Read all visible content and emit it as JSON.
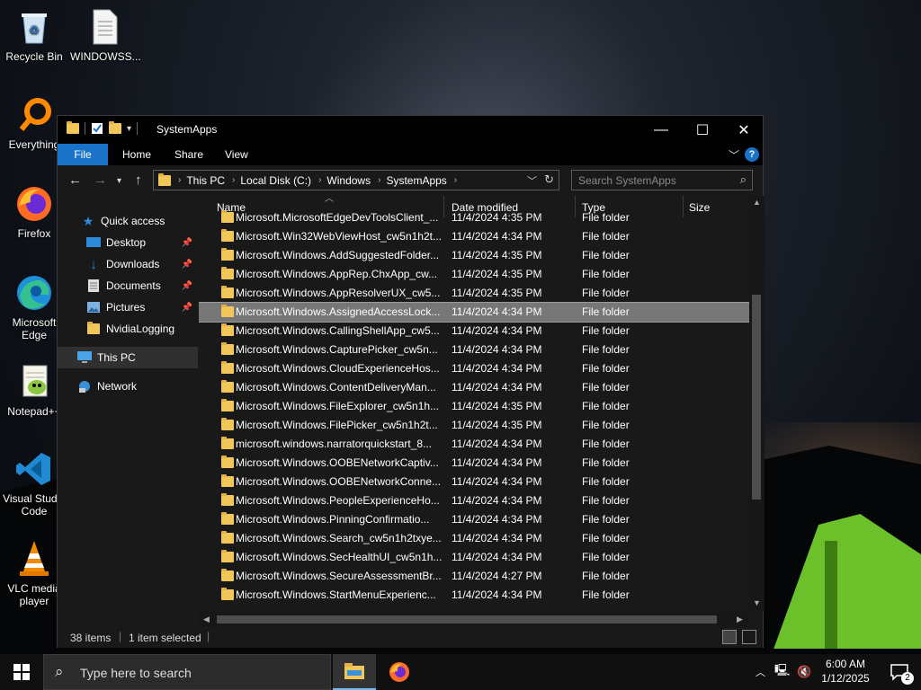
{
  "desktop": {
    "icons": [
      {
        "label": "Recycle Bin"
      },
      {
        "label": "WINDOWSS..."
      },
      {
        "label": "Everything"
      },
      {
        "label": "Firefox"
      },
      {
        "label": "Microsoft Edge"
      },
      {
        "label": "Notepad++"
      },
      {
        "label": "Visual Studio Code"
      },
      {
        "label": "VLC media player"
      }
    ]
  },
  "window": {
    "title": "SystemApps",
    "controls": {
      "minimize": "—",
      "maximize": "☐",
      "close": "✕"
    },
    "ribbon_tabs": [
      "File",
      "Home",
      "Share",
      "View"
    ],
    "help": "?",
    "address": {
      "crumbs": [
        "This PC",
        "Local Disk (C:)",
        "Windows",
        "SystemApps"
      ]
    },
    "search": {
      "placeholder": "Search SystemApps"
    },
    "nav": {
      "quick_access": "Quick access",
      "items": [
        {
          "label": "Desktop",
          "pinned": true
        },
        {
          "label": "Downloads",
          "pinned": true
        },
        {
          "label": "Documents",
          "pinned": true
        },
        {
          "label": "Pictures",
          "pinned": true
        },
        {
          "label": "NvidiaLogging",
          "pinned": false
        }
      ],
      "this_pc": "This PC",
      "network": "Network"
    },
    "columns": {
      "name": "Name",
      "date": "Date modified",
      "type": "Type",
      "size": "Size"
    },
    "files": [
      {
        "name": "Microsoft.MicrosoftEdgeDevToolsClient_...",
        "date": "11/4/2024 4:35 PM",
        "type": "File folder"
      },
      {
        "name": "Microsoft.Win32WebViewHost_cw5n1h2t...",
        "date": "11/4/2024 4:34 PM",
        "type": "File folder"
      },
      {
        "name": "Microsoft.Windows.AddSuggestedFolder...",
        "date": "11/4/2024 4:35 PM",
        "type": "File folder"
      },
      {
        "name": "Microsoft.Windows.AppRep.ChxApp_cw...",
        "date": "11/4/2024 4:35 PM",
        "type": "File folder"
      },
      {
        "name": "Microsoft.Windows.AppResolverUX_cw5...",
        "date": "11/4/2024 4:35 PM",
        "type": "File folder"
      },
      {
        "name": "Microsoft.Windows.AssignedAccessLock...",
        "date": "11/4/2024 4:34 PM",
        "type": "File folder",
        "selected": true
      },
      {
        "name": "Microsoft.Windows.CallingShellApp_cw5...",
        "date": "11/4/2024 4:34 PM",
        "type": "File folder"
      },
      {
        "name": "Microsoft.Windows.CapturePicker_cw5n...",
        "date": "11/4/2024 4:34 PM",
        "type": "File folder"
      },
      {
        "name": "Microsoft.Windows.CloudExperienceHos...",
        "date": "11/4/2024 4:34 PM",
        "type": "File folder"
      },
      {
        "name": "Microsoft.Windows.ContentDeliveryMan...",
        "date": "11/4/2024 4:34 PM",
        "type": "File folder"
      },
      {
        "name": "Microsoft.Windows.FileExplorer_cw5n1h...",
        "date": "11/4/2024 4:35 PM",
        "type": "File folder"
      },
      {
        "name": "Microsoft.Windows.FilePicker_cw5n1h2t...",
        "date": "11/4/2024 4:35 PM",
        "type": "File folder"
      },
      {
        "name": "microsoft.windows.narratorquickstart_8...",
        "date": "11/4/2024 4:34 PM",
        "type": "File folder"
      },
      {
        "name": "Microsoft.Windows.OOBENetworkCaptiv...",
        "date": "11/4/2024 4:34 PM",
        "type": "File folder"
      },
      {
        "name": "Microsoft.Windows.OOBENetworkConne...",
        "date": "11/4/2024 4:34 PM",
        "type": "File folder"
      },
      {
        "name": "Microsoft.Windows.PeopleExperienceHo...",
        "date": "11/4/2024 4:34 PM",
        "type": "File folder"
      },
      {
        "name": "Microsoft.Windows.PinningConfirmatio...",
        "date": "11/4/2024 4:34 PM",
        "type": "File folder"
      },
      {
        "name": "Microsoft.Windows.Search_cw5n1h2txye...",
        "date": "11/4/2024 4:34 PM",
        "type": "File folder"
      },
      {
        "name": "Microsoft.Windows.SecHealthUI_cw5n1h...",
        "date": "11/4/2024 4:34 PM",
        "type": "File folder"
      },
      {
        "name": "Microsoft.Windows.SecureAssessmentBr...",
        "date": "11/4/2024 4:27 PM",
        "type": "File folder"
      },
      {
        "name": "Microsoft.Windows.StartMenuExperienc...",
        "date": "11/4/2024 4:34 PM",
        "type": "File folder"
      }
    ],
    "status": {
      "count": "38 items",
      "selected": "1 item selected"
    }
  },
  "taskbar": {
    "search_placeholder": "Type here to search",
    "time": "6:00 AM",
    "date": "1/12/2025",
    "notifications": "2"
  },
  "colors": {
    "accent": "#1a73c8",
    "folder": "#f2c75a",
    "selection": "#777777"
  }
}
